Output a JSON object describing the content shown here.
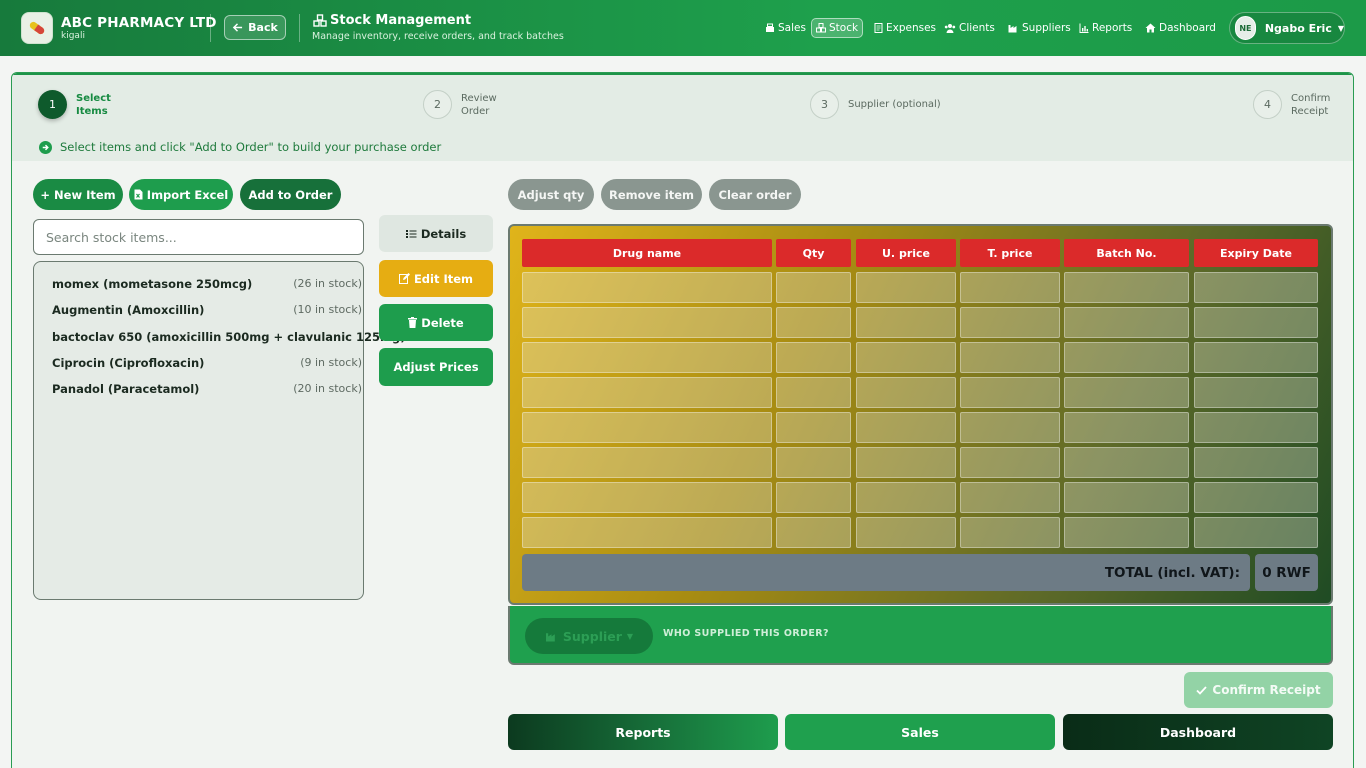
{
  "header": {
    "brand": "ABC PHARMACY LTD",
    "location": "kigali",
    "back_label": "Back",
    "page_title": "Stock Management",
    "page_subtitle": "Manage inventory, receive orders, and track batches",
    "nav": [
      {
        "label": "Sales",
        "icon": "cash-register-icon"
      },
      {
        "label": "Stock",
        "icon": "boxes-icon",
        "active": true
      },
      {
        "label": "Expenses",
        "icon": "receipt-icon"
      },
      {
        "label": "Clients",
        "icon": "users-icon"
      },
      {
        "label": "Suppliers",
        "icon": "industry-icon"
      },
      {
        "label": "Reports",
        "icon": "chart-icon"
      },
      {
        "label": "Dashboard",
        "icon": "home-icon"
      }
    ],
    "user": {
      "initials": "NE",
      "name": "Ngabo Eric"
    }
  },
  "steps": [
    {
      "num": "1",
      "label": "Select\nItems",
      "active": true
    },
    {
      "num": "2",
      "label": "Review\nOrder"
    },
    {
      "num": "3",
      "label": "Supplier (optional)"
    },
    {
      "num": "4",
      "label": "Confirm\nReceipt"
    }
  ],
  "hint": "Select items and click \"Add to Order\" to build your purchase order",
  "toolbar": {
    "new_item": "+ New Item",
    "import_excel": "Import Excel",
    "add_to_order": "Add to Order",
    "adjust_qty": "Adjust qty",
    "remove_item": "Remove item",
    "clear_order": "Clear order"
  },
  "search": {
    "placeholder": "Search stock items..."
  },
  "stock_items": [
    {
      "name": "momex (mometasone 250mcg)",
      "stock": "(26 in stock)"
    },
    {
      "name": "Augmentin (Amoxcillin)",
      "stock": "(10 in stock)"
    },
    {
      "name": "bactoclav 650 (amoxicillin 500mg + clavulanic 125mg)",
      "stock": ""
    },
    {
      "name": "Ciprocin (Ciprofloxacin)",
      "stock": "(9 in stock)"
    },
    {
      "name": "Panadol (Paracetamol)",
      "stock": "(20 in stock)"
    }
  ],
  "actions": {
    "details": "Details",
    "edit_item": "Edit Item",
    "delete": "Delete",
    "adjust_prices": "Adjust Prices"
  },
  "order_table": {
    "columns": [
      "Drug name",
      "Qty",
      "U. price",
      "T. price",
      "Batch No.",
      "Expiry Date"
    ],
    "empty_rows": 8,
    "total_label": "TOTAL (incl. VAT):",
    "total_value": "0 RWF"
  },
  "supplier": {
    "button": "Supplier",
    "label": "WHO SUPPLIED THIS ORDER?"
  },
  "confirm_receipt": "Confirm Receipt",
  "bottom_nav": {
    "reports": "Reports",
    "sales": "Sales",
    "dashboard": "Dashboard"
  },
  "colors": {
    "primary": "#1e9d4d",
    "dark": "#0c3a1f",
    "header_red": "#db2a2a",
    "warning": "#e6ad12"
  }
}
